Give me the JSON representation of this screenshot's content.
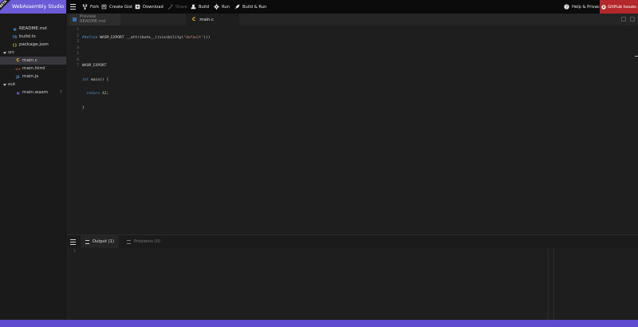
{
  "app": {
    "title": "WebAssembly Studio",
    "badge": "BETA"
  },
  "toolbar": {
    "fork": "Fork",
    "create_gist": "Create Gist",
    "download": "Download",
    "share": "Share",
    "build": "Build",
    "run": "Run",
    "build_run": "Build & Run",
    "help": "Help & Privacy",
    "github_issues": "GitHub Issues"
  },
  "files": {
    "readme": "README.md",
    "build_ts": "build.ts",
    "package_json": "package.json",
    "src_folder": "src",
    "main_c": "main.c",
    "main_html": "main.html",
    "main_js": "main.js",
    "out_folder": "out",
    "main_wasm": "main.wasm",
    "wasm_badge": "T",
    "icons": {
      "md": "▣",
      "ts": "TS",
      "json": "{}",
      "c": "C",
      "html": "<>",
      "js": "JS",
      "wasm": "▣"
    }
  },
  "tabs": {
    "preview_line1": "Preview",
    "preview_line2": "README.md",
    "active": "main.c",
    "active_icon": "C"
  },
  "editor": {
    "line_numbers": [
      "1",
      "2",
      "3",
      "4",
      "5",
      "6",
      "7"
    ],
    "lines": {
      "l1": {
        "define": "#define",
        "rest": " WASM_EXPORT __attribute__((visibility(",
        "str": "\"default\"",
        "end": ")))"
      },
      "l3": "WASM_EXPORT",
      "l4": {
        "kw": "int",
        "rest": " main() {"
      },
      "l5": {
        "kw": "return",
        "num": "42",
        "end": ";"
      },
      "l6": "}"
    }
  },
  "panel": {
    "output_tab": "Output (1)",
    "problems_tab": "Problems (0)",
    "line_number": "1"
  },
  "colors": {
    "accent": "#6b5bd6",
    "status_bar": "#5f4bd0",
    "issues": "#b4282c"
  }
}
